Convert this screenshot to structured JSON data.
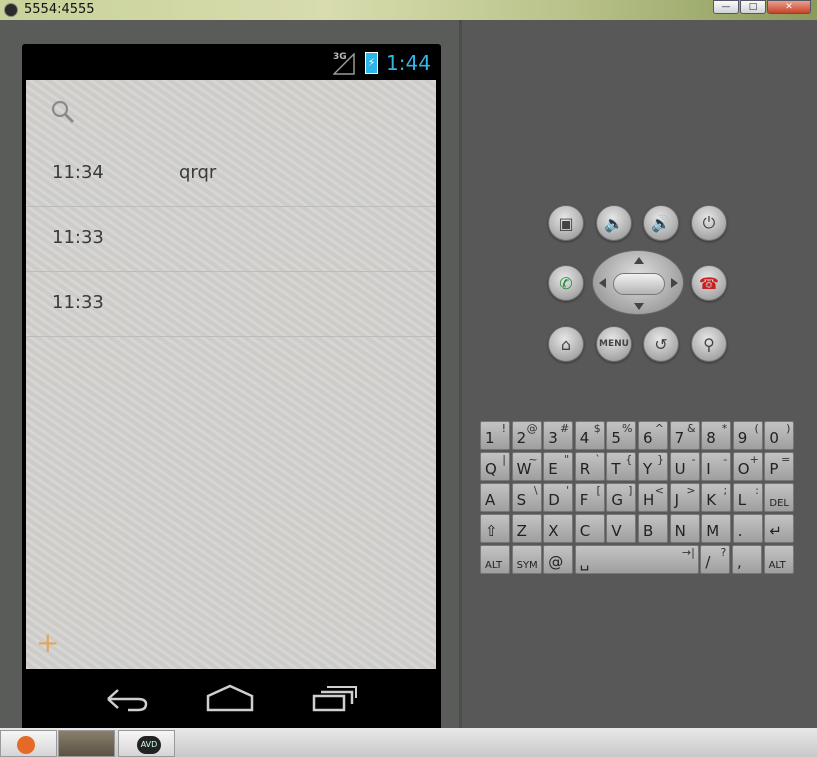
{
  "window": {
    "title": "5554:4555"
  },
  "status_bar": {
    "network": "3G",
    "time": "1:44"
  },
  "notes": [
    {
      "time": "11:34",
      "title": "qrqr"
    },
    {
      "time": "11:33",
      "title": ""
    },
    {
      "time": "11:33",
      "title": ""
    }
  ],
  "hardware_buttons": {
    "menu": "MENU"
  },
  "keyboard": {
    "rows": [
      [
        {
          "m": "1",
          "s": "!"
        },
        {
          "m": "2",
          "s": "@"
        },
        {
          "m": "3",
          "s": "#"
        },
        {
          "m": "4",
          "s": "$"
        },
        {
          "m": "5",
          "s": "%"
        },
        {
          "m": "6",
          "s": "^"
        },
        {
          "m": "7",
          "s": "&"
        },
        {
          "m": "8",
          "s": "*"
        },
        {
          "m": "9",
          "s": "("
        },
        {
          "m": "0",
          "s": ")"
        }
      ],
      [
        {
          "m": "Q",
          "s": "|"
        },
        {
          "m": "W",
          "s": "~"
        },
        {
          "m": "E",
          "s": "\""
        },
        {
          "m": "R",
          "s": "`"
        },
        {
          "m": "T",
          "s": "{"
        },
        {
          "m": "Y",
          "s": "}"
        },
        {
          "m": "U",
          "s": "-"
        },
        {
          "m": "I",
          "s": "-"
        },
        {
          "m": "O",
          "s": "+"
        },
        {
          "m": "P",
          "s": "="
        }
      ],
      [
        {
          "m": "A",
          "s": ""
        },
        {
          "m": "S",
          "s": "\\"
        },
        {
          "m": "D",
          "s": "'"
        },
        {
          "m": "F",
          "s": "["
        },
        {
          "m": "G",
          "s": "]"
        },
        {
          "m": "H",
          "s": "<"
        },
        {
          "m": "J",
          "s": ">"
        },
        {
          "m": "K",
          "s": ";"
        },
        {
          "m": "L",
          "s": ":"
        },
        {
          "m": "DEL",
          "s": ""
        }
      ],
      [
        {
          "m": "⇧",
          "s": ""
        },
        {
          "m": "Z",
          "s": ""
        },
        {
          "m": "X",
          "s": ""
        },
        {
          "m": "C",
          "s": ""
        },
        {
          "m": "V",
          "s": ""
        },
        {
          "m": "B",
          "s": ""
        },
        {
          "m": "N",
          "s": ""
        },
        {
          "m": "M",
          "s": ""
        },
        {
          "m": ".",
          "s": ""
        },
        {
          "m": "↵",
          "s": ""
        }
      ],
      [
        {
          "m": "ALT",
          "s": ""
        },
        {
          "m": "SYM",
          "s": ""
        },
        {
          "m": "@",
          "s": ""
        },
        {
          "m": "␣",
          "s": "→|"
        },
        {
          "m": "/",
          "s": "?"
        },
        {
          "m": ",",
          "s": ""
        },
        {
          "m": "ALT",
          "s": ""
        }
      ]
    ]
  },
  "taskbar": {
    "avd_label": "AVD"
  }
}
